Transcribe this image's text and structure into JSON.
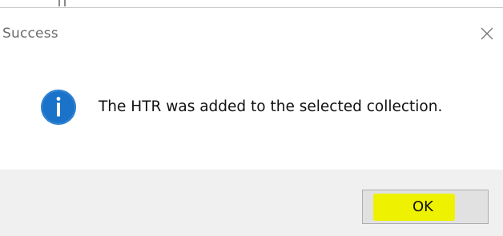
{
  "window": {
    "title": "Success",
    "close_icon": "close-icon"
  },
  "message": {
    "icon": "info-icon",
    "text": "The HTR was added to the selected collection."
  },
  "buttons": {
    "ok_label": "OK"
  },
  "colors": {
    "info_icon_fill": "#1a73c9",
    "highlight": "#eef200",
    "footer_bg": "#f0f0f0",
    "button_bg": "#e1e1e1"
  }
}
